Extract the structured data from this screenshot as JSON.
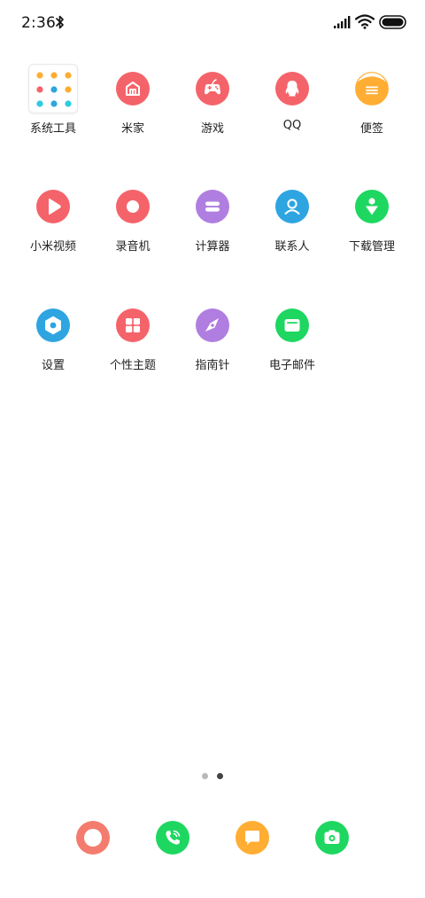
{
  "status_bar": {
    "time": "2:36",
    "icons": [
      "bluetooth-icon",
      "signal-icon",
      "wifi-icon",
      "battery-icon"
    ]
  },
  "apps": [
    {
      "label": "系统工具",
      "icon": "folder-icon",
      "color": "#ffffff"
    },
    {
      "label": "米家",
      "icon": "mijia-home-icon",
      "color": "#f5636a"
    },
    {
      "label": "游戏",
      "icon": "gamepad-icon",
      "color": "#f5636a"
    },
    {
      "label": "QQ",
      "icon": "qq-penguin-icon",
      "color": "#f5636a"
    },
    {
      "label": "便签",
      "icon": "notes-icon",
      "color": "#ffad33"
    },
    {
      "label": "小米视频",
      "icon": "video-play-icon",
      "color": "#f5636a"
    },
    {
      "label": "录音机",
      "icon": "record-icon",
      "color": "#f5636a"
    },
    {
      "label": "计算器",
      "icon": "calculator-icon",
      "color": "#b07ee0"
    },
    {
      "label": "联系人",
      "icon": "contacts-icon",
      "color": "#2ea5e0"
    },
    {
      "label": "下载管理",
      "icon": "download-icon",
      "color": "#1ed760"
    },
    {
      "label": "设置",
      "icon": "gear-icon",
      "color": "#2ea5e0"
    },
    {
      "label": "个性主题",
      "icon": "themes-icon",
      "color": "#f5636a"
    },
    {
      "label": "指南针",
      "icon": "compass-icon",
      "color": "#b07ee0"
    },
    {
      "label": "电子邮件",
      "icon": "email-icon",
      "color": "#1ed760"
    }
  ],
  "page_indicator": {
    "pages": 2,
    "current": 2
  },
  "dock": [
    {
      "icon": "browser-icon",
      "color": "#f47c6e"
    },
    {
      "icon": "phone-icon",
      "color": "#1ed760"
    },
    {
      "icon": "messages-icon",
      "color": "#ffad33"
    },
    {
      "icon": "camera-icon",
      "color": "#1ed760"
    }
  ]
}
